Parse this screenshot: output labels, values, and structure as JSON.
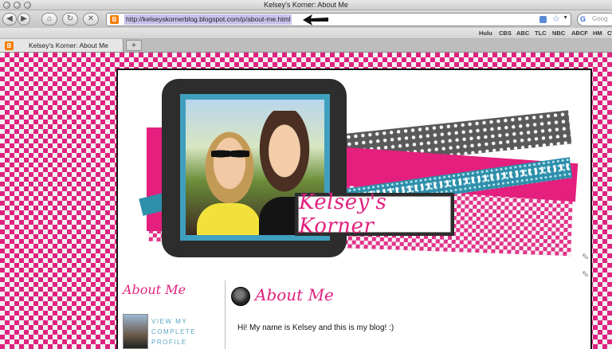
{
  "window": {
    "title": "Kelsey's Korner: About Me"
  },
  "toolbar": {
    "back_icon": "◀",
    "forward_icon": "▶",
    "home_icon": "⌂",
    "reload_icon": "↻",
    "stop_icon": "✕",
    "url": "http://kelseyskornerblog.blogspot.com/p/about-me.html",
    "search_placeholder": "Goog",
    "search_logo": "G"
  },
  "bookmarks": [
    "Hulu",
    "CBS",
    "ABC",
    "TLC",
    "NBC",
    "ABCF",
    "HM",
    "CW"
  ],
  "tabs": [
    {
      "title": "Kelsey's Korner: About Me"
    }
  ],
  "new_tab_label": "+",
  "favicon_letter": "B",
  "blog": {
    "title": "Kelsey's Korner",
    "sidebar": {
      "heading": "About Me",
      "profile_link": "View my complete profile"
    },
    "post": {
      "title": "About Me",
      "body": "Hi!  My name is Kelsey and this is my blog!  :)"
    }
  },
  "colors": {
    "brand_pink": "#e0227f",
    "accent_teal": "#3f9fbf",
    "link_blue": "#5aa7c2"
  }
}
